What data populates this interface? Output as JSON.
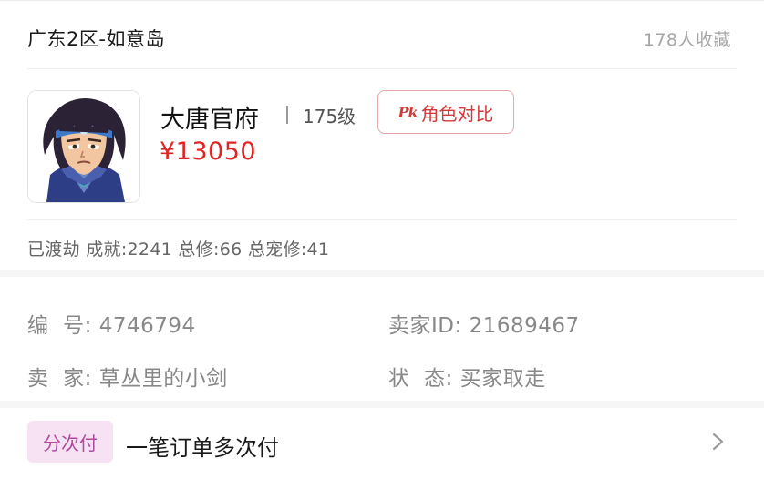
{
  "header": {
    "server": "广东2区-如意岛",
    "favorites": "178人收藏"
  },
  "role": {
    "avatar_icon": "character-avatar-icon",
    "school": "大唐官府",
    "level": "175级",
    "compare_icon_text": "Pk",
    "compare_label": "角色对比",
    "price": "¥13050",
    "stats": "已渡劫 成就:2241 总修:66 总宠修:41"
  },
  "info": {
    "number_label": "编  号:",
    "number_value": "4746794",
    "seller_id_label": "卖家ID:",
    "seller_id_value": "21689467",
    "seller_label": "卖  家:",
    "seller_value": "草丛里的小剑",
    "status_label": "状  态:",
    "status_value": "买家取走"
  },
  "payment": {
    "badge": "分次付",
    "description": "一笔订单多次付",
    "chevron_icon": "chevron-right-icon"
  },
  "colors": {
    "price": "#e02424",
    "accent_red": "#d33b3b",
    "badge_bg": "#f6e2f3",
    "badge_text": "#b04ba0"
  }
}
